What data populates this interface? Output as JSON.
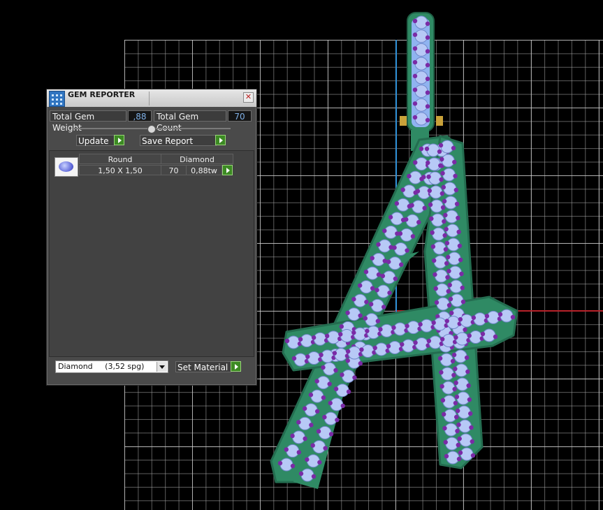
{
  "panel": {
    "title": "GEM REPORTER",
    "close_glyph": "✕",
    "total_gem_weight_label": "Total Gem Weight",
    "total_gem_weight_value": ",88",
    "total_gem_count_label": "Total Gem Count",
    "total_gem_count_value": "70",
    "update_label": "Update",
    "save_report_label": "Save Report",
    "table": {
      "row": {
        "shape": "Round",
        "material": "Diamond",
        "size": "1,50 X 1,50",
        "count": "70",
        "weight": "0,88tw"
      }
    },
    "material_select": {
      "value": "Diamond     (3,52 spg)"
    },
    "set_material_label": "Set Material"
  },
  "colors": {
    "gem": "#b7c9f6",
    "prong": "#7a2aa6",
    "metal": "#2f8a64",
    "axis_x": "#b8222a",
    "axis_y": "#2e8fd6"
  },
  "icons": {
    "title": "gem-reporter-icon",
    "close": "close-icon",
    "go": "play-arrow-icon",
    "gem": "round-gem-icon",
    "dropdown": "chevron-down-icon"
  }
}
